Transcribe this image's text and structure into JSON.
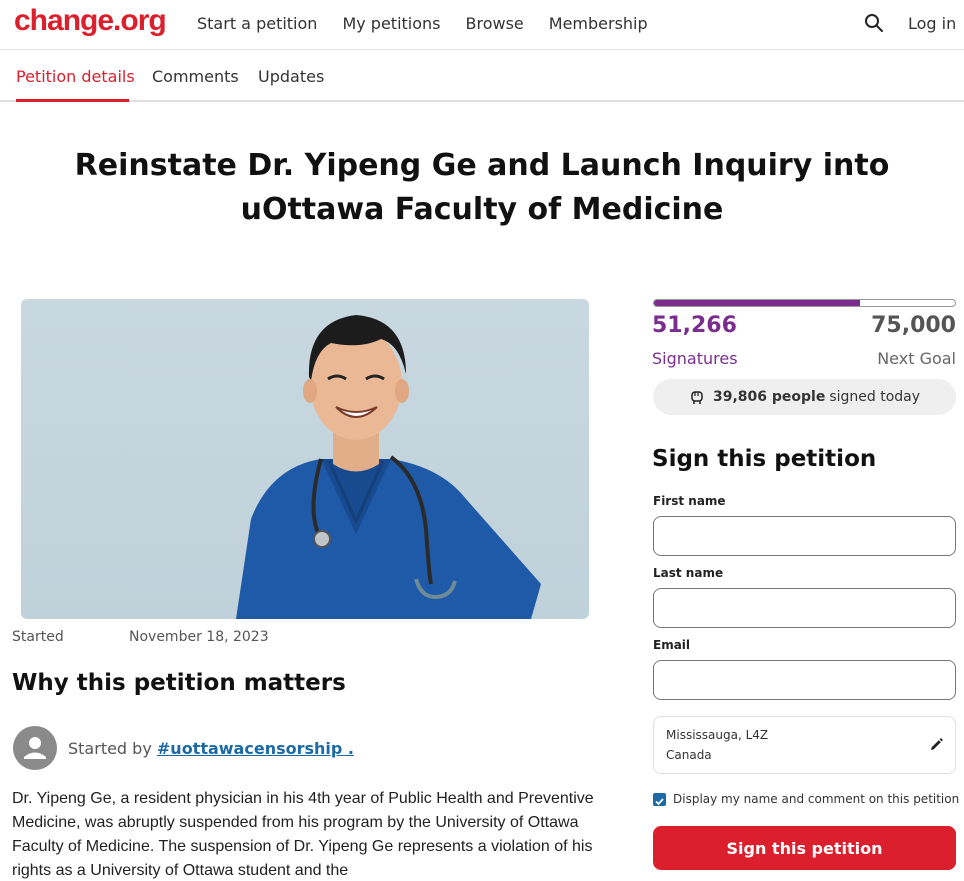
{
  "header": {
    "logo": "change.org",
    "nav": [
      "Start a petition",
      "My petitions",
      "Browse",
      "Membership"
    ],
    "login": "Log in",
    "search_icon": "search-icon"
  },
  "tabs": [
    "Petition details",
    "Comments",
    "Updates"
  ],
  "petition": {
    "title": "Reinstate Dr. Yipeng Ge and Launch Inquiry into uOttawa Faculty of Medicine",
    "started_label": "Started",
    "started_date": "November 18, 2023",
    "why_heading": "Why this petition matters",
    "started_by_prefix": "Started by",
    "started_by_handle": "#uottawacensorship .",
    "body": "Dr. Yipeng Ge, a resident physician in his 4th year of Public Health and Preventive Medicine, was abruptly suspended from his program by the University of Ottawa Faculty of Medicine. The suspension of Dr. Yipeng Ge represents a violation of his rights as a University of Ottawa student and the"
  },
  "signatures": {
    "count": "51,266",
    "count_label": "Signatures",
    "goal": "75,000",
    "goal_label": "Next Goal",
    "progress": 0.684,
    "today_count": "39,806 people",
    "today_suffix": "signed today"
  },
  "form": {
    "heading": "Sign this petition",
    "first_name_label": "First name",
    "last_name_label": "Last name",
    "email_label": "Email",
    "first_name_value": "",
    "last_name_value": "",
    "email_value": "",
    "location_line1": "Mississauga, L4Z",
    "location_line2": "Canada",
    "display_checkbox_label": "Display my name and comment on this petition",
    "submit_label": "Sign this petition"
  },
  "colors": {
    "brand_red": "#db1f2c",
    "purple": "#7b2d8e",
    "link_blue": "#1b6aa5"
  }
}
